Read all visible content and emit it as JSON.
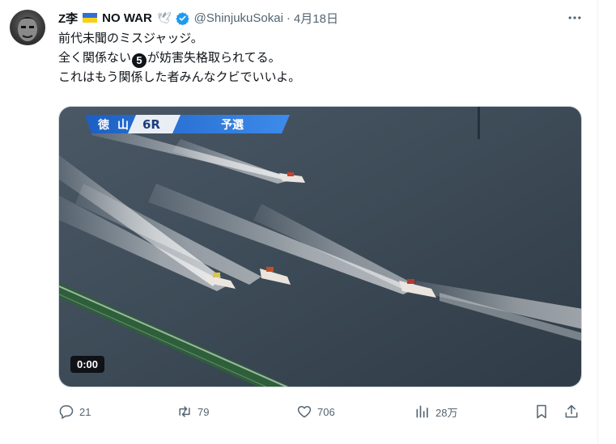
{
  "tweet": {
    "display_name": "Z李",
    "no_war": "NO WAR",
    "handle": "@ShinjukuSokai",
    "separator": "·",
    "date": "4月18日",
    "lines": {
      "l1": "前代未聞のミスジャッジ。",
      "l2_pre": "全く関係ない",
      "l2_num": "5",
      "l2_post": "が妨害失格取られてる。",
      "l3": "これはもう関係した者みんなクビでいいよ。"
    }
  },
  "media": {
    "overlay_venue_1": "徳",
    "overlay_venue_2": "山",
    "overlay_race": "6R",
    "overlay_stage": "予選",
    "timestamp": "0:00"
  },
  "actions": {
    "replies": "21",
    "reposts": "79",
    "likes": "706",
    "views": "28万"
  },
  "colors": {
    "accent": "#1d9bf0",
    "muted": "#536471",
    "water": "#3e4d5a"
  },
  "icons": [
    "more-icon",
    "verified-badge-icon",
    "dove-icon",
    "reply-icon",
    "repost-icon",
    "like-icon",
    "views-icon",
    "bookmark-icon",
    "share-icon"
  ]
}
